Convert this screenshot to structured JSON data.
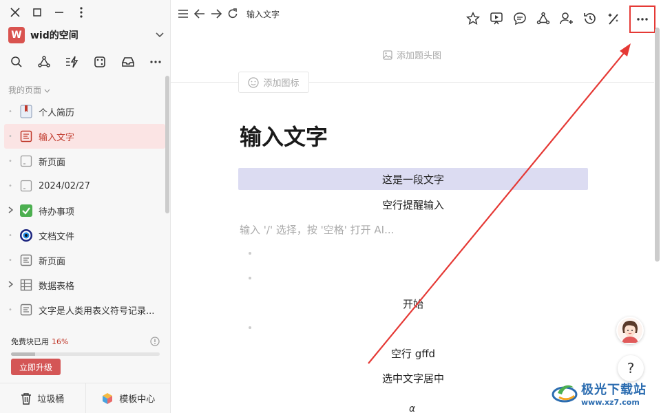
{
  "sidebar": {
    "space": {
      "badge": "W",
      "name": "wid的空间"
    },
    "section_label": "我的页面",
    "items": [
      {
        "label": "个人简历",
        "icon": "bookmark-page-icon",
        "expandable": false,
        "active": false
      },
      {
        "label": "输入文字",
        "icon": "doc-icon",
        "expandable": false,
        "active": true
      },
      {
        "label": "新页面",
        "icon": "blank-page-icon",
        "expandable": false,
        "active": false
      },
      {
        "label": "2024/02/27",
        "icon": "blank-page-icon",
        "expandable": false,
        "active": false
      },
      {
        "label": "待办事项",
        "icon": "checkbox-checked-icon",
        "expandable": true,
        "active": false
      },
      {
        "label": "文档文件",
        "icon": "eye-icon",
        "expandable": false,
        "active": false
      },
      {
        "label": "新页面",
        "icon": "doc-icon",
        "expandable": false,
        "active": false
      },
      {
        "label": "数据表格",
        "icon": "table-icon",
        "expandable": true,
        "active": false
      },
      {
        "label": "文字是人类用表义符号记录...",
        "icon": "doc-icon",
        "expandable": false,
        "active": false
      }
    ],
    "usage": {
      "label": "免费块已用",
      "percent_text": "16%",
      "fraction": 0.16
    },
    "upgrade_label": "立即升级",
    "trash_label": "垃圾桶",
    "templates_label": "模板中心"
  },
  "topbar": {
    "breadcrumb": "输入文字"
  },
  "page": {
    "add_cover": "添加题头图",
    "add_icon": "添加图标",
    "title": "输入文字",
    "highlighted_line": "这是一段文字",
    "line2": "空行提醒输入",
    "placeholder": "输入 '/' 选择，按 '空格' 打开 AI...",
    "line_start": "开始",
    "line_gffd": "空行 gffd",
    "line_center": "选中文字居中",
    "alpha": "α"
  },
  "help_label": "?",
  "watermark": {
    "brand": "极光下载站",
    "url": "www.xz7.com"
  },
  "colors": {
    "accent": "#d45656",
    "highlight": "#dcdcf2",
    "annotation": "#e53935"
  }
}
